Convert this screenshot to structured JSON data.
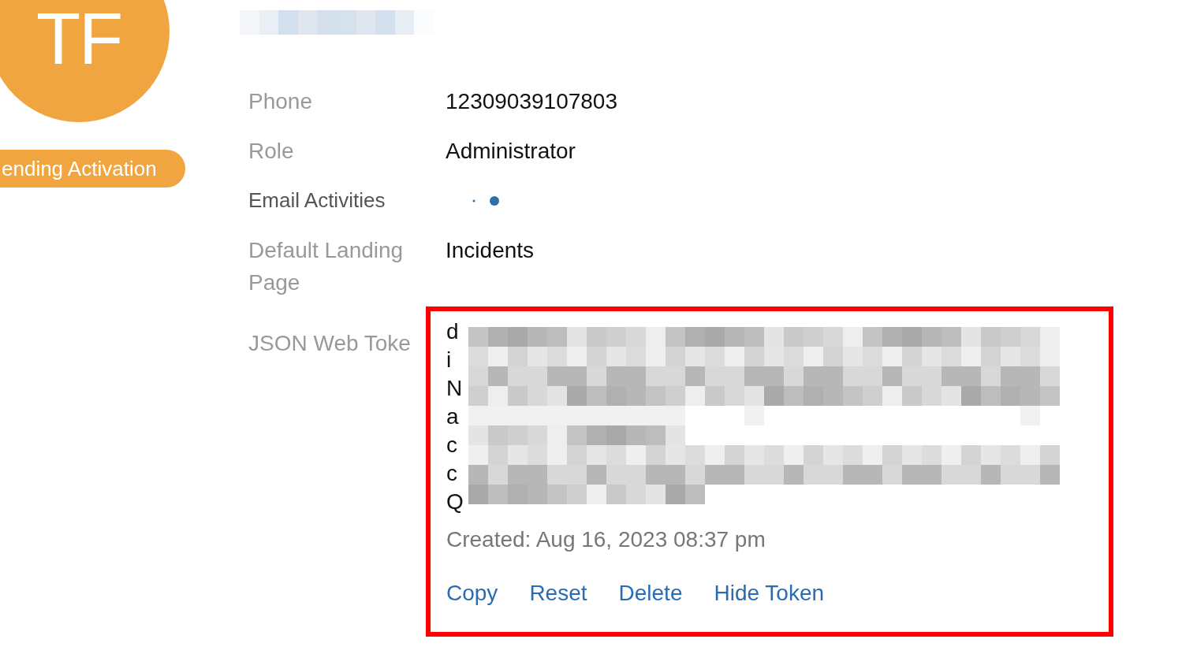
{
  "avatar": {
    "initials": "TF"
  },
  "status_badge": "ending Activation",
  "fields": [
    {
      "kind": "text",
      "label": "Phone",
      "value": "12309039107803"
    },
    {
      "kind": "text",
      "label": "Role",
      "value": "Administrator"
    },
    {
      "kind": "dots",
      "label": "Email Activities"
    },
    {
      "kind": "text",
      "label": "Default Landing Page",
      "value": "Incidents"
    }
  ],
  "token": {
    "label": "JSON Web Toke",
    "lines": [
      "d",
      "i",
      "N",
      "a",
      "c",
      "c",
      "Q"
    ],
    "created": "Created: Aug 16, 2023 08:37 pm",
    "actions": [
      "Copy",
      "Reset",
      "Delete",
      "Hide Token"
    ]
  }
}
